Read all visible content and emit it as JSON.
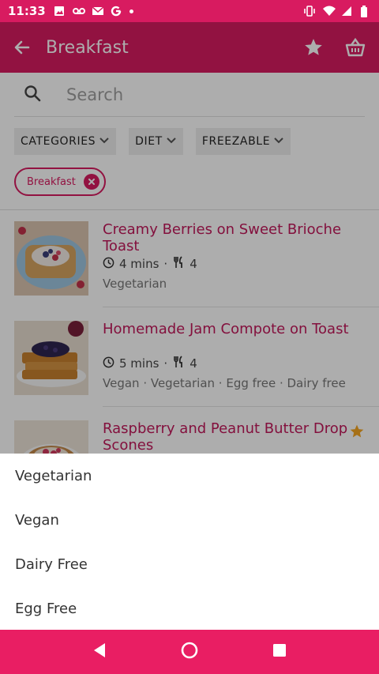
{
  "status_bar": {
    "time": "11:33"
  },
  "app_bar": {
    "title": "Breakfast"
  },
  "search": {
    "placeholder": "Search"
  },
  "filters": {
    "categories_label": "CATEGORIES",
    "diet_label": "DIET",
    "freezable_label": "FREEZABLE",
    "selected_chip": "Breakfast"
  },
  "recipes": [
    {
      "title": "Creamy Berries on Sweet Brioche Toast",
      "time": "4 mins",
      "serves": "4",
      "tags": "Vegetarian",
      "favourite": false
    },
    {
      "title": "Homemade Jam Compote on Toast",
      "time": "5 mins",
      "serves": "4",
      "tags": "Vegan · Vegetarian · Egg free · Dairy free",
      "favourite": false
    },
    {
      "title": "Raspberry and Peanut Butter Drop Scones",
      "favourite": true
    }
  ],
  "diet_options": [
    "Vegetarian",
    "Vegan",
    "Dairy Free",
    "Egg Free"
  ],
  "colors": {
    "primary": "#d81b60",
    "title_text": "#c2185b",
    "star": "#f5a623",
    "nav_bar": "#e91e63"
  },
  "icons": [
    "back-arrow-icon",
    "star-icon",
    "basket-icon",
    "search-icon",
    "chevron-down-icon",
    "close-icon",
    "clock-icon",
    "cutlery-icon",
    "nav-back-icon",
    "nav-home-icon",
    "nav-recents-icon"
  ]
}
